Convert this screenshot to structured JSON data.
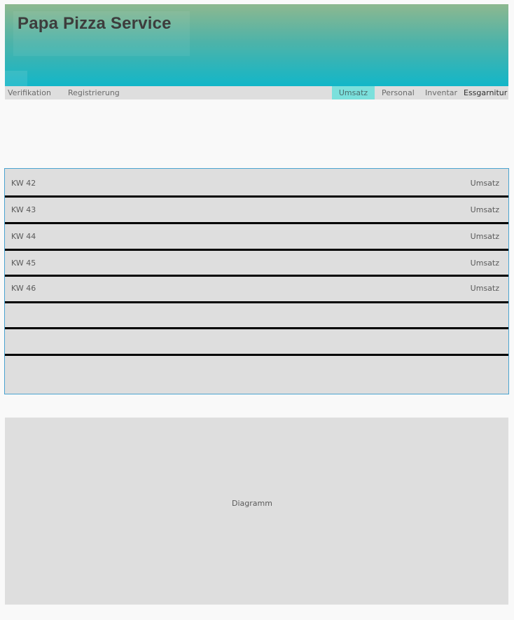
{
  "app": {
    "title": "Papa Pizza Service"
  },
  "colors": {
    "header_top": "#8db88f",
    "header_bottom": "#12b6c8",
    "nav_active": "#7be0dc",
    "panel_border": "#4aa3d0",
    "row_divider": "#000000",
    "panel_bg": "#dedede"
  },
  "nav": {
    "left": [
      {
        "label": "Verifikation"
      },
      {
        "label": "Registrierung"
      }
    ],
    "right": [
      {
        "label": "Umsatz",
        "active": true
      },
      {
        "label": "Personal",
        "active": false
      },
      {
        "label": "Inventar",
        "active": false
      },
      {
        "label": "Essgarnitur",
        "active": false
      }
    ]
  },
  "weeks": [
    {
      "label": "KW 42",
      "value": "Umsatz"
    },
    {
      "label": "KW 43",
      "value": "Umsatz"
    },
    {
      "label": "KW 44",
      "value": "Umsatz"
    },
    {
      "label": "KW 45",
      "value": "Umsatz"
    },
    {
      "label": "KW 46",
      "value": "Umsatz"
    },
    {
      "label": "",
      "value": ""
    },
    {
      "label": "",
      "value": ""
    },
    {
      "label": "",
      "value": ""
    }
  ],
  "diagram": {
    "label": "Diagramm"
  }
}
